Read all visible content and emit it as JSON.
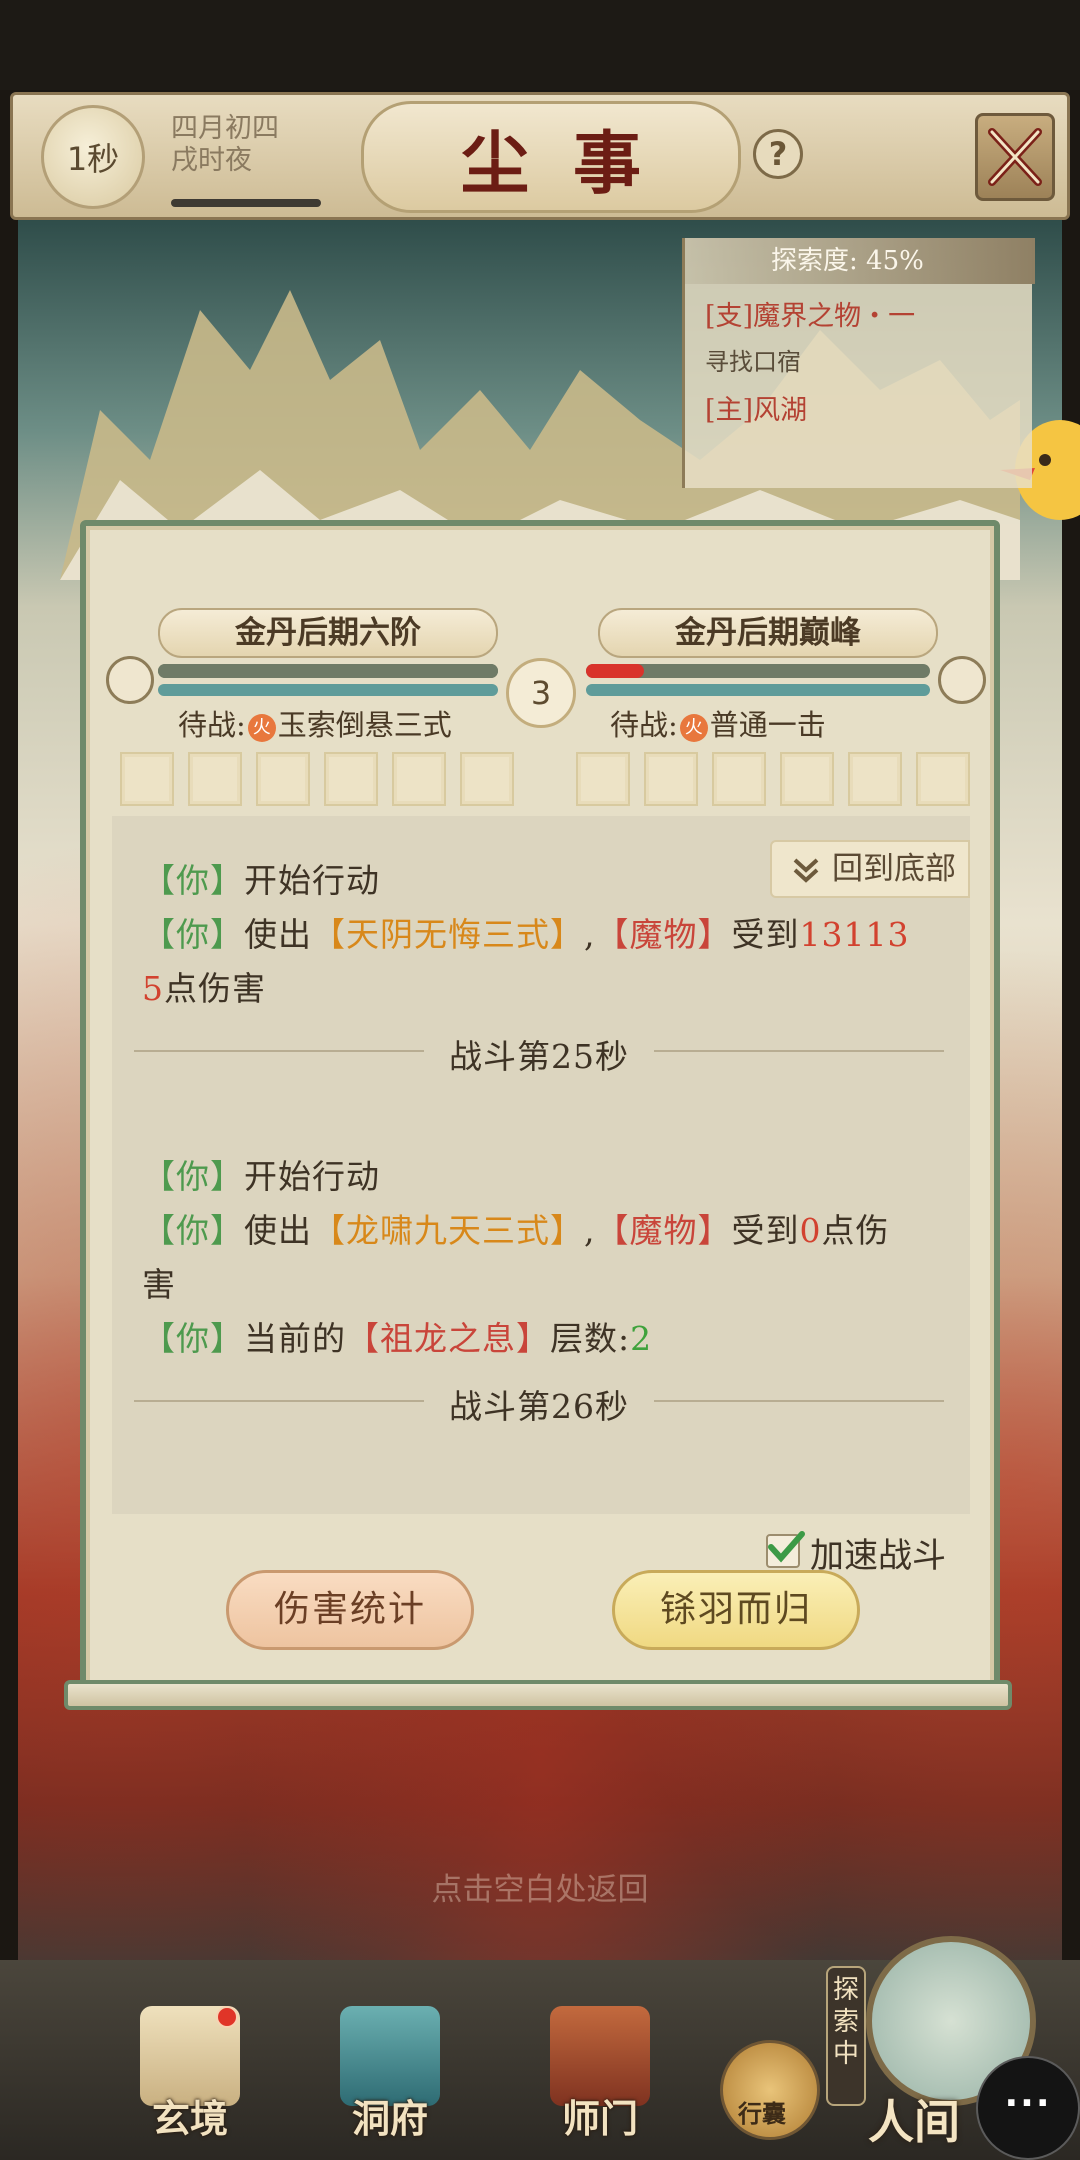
{
  "header": {
    "timer": "1秒",
    "date_line1": "四月初四",
    "date_line2": "戌时夜",
    "title": "尘事",
    "help": "?"
  },
  "quest": {
    "progress": "探索度: 45%",
    "item1": "[支]魔界之物・一",
    "item1_sub": "寻找口宿",
    "item2": "[主]风湖"
  },
  "battle": {
    "player_rank": "金丹后期六阶",
    "enemy_rank": "金丹后期巅峰",
    "round": "3",
    "player_wait_label": "待战:",
    "player_wait_skill": "玉索倒悬三式",
    "enemy_wait_label": "待战:",
    "enemy_wait_skill": "普通一击",
    "fire_glyph": "火",
    "enemy_hp_fraction": 0.17,
    "player_hp_fraction": 1.0,
    "back_to_bottom": "回到底部",
    "log": {
      "you": "【你】",
      "start_action": "开始行动",
      "use": "使出",
      "skill1": "【天阴无悔三式】",
      "comma": ",",
      "monster": "【魔物】",
      "received": "受到",
      "dmg1_a": "13113",
      "dmg1_b": "5",
      "dmg_suffix": "点伤害",
      "sep1": "战斗第25秒",
      "skill2": "【龙啸九天三式】",
      "dmg2": "0",
      "dmg2_suffix_a": "点伤",
      "dmg2_suffix_b": "害",
      "current_of": "当前的",
      "buff": "【祖龙之息】",
      "layers": "层数:",
      "layer_count": "2",
      "sep2": "战斗第26秒"
    },
    "speed_up": "加速战斗",
    "speed_up_checked": true,
    "btn_damage_stats": "伤害统计",
    "btn_return": "铩羽而归"
  },
  "hint": "点击空白处返回",
  "nav": {
    "item1": "玄境",
    "item2": "洞府",
    "item3": "师门",
    "bag": "行囊",
    "exploring": "探索中",
    "world": "人间",
    "more": "···"
  },
  "colors": {
    "frame_green": "#6f8a6a",
    "you_green": "#4e9a4e",
    "skill_orange": "#d8881a",
    "monster_red": "#c9453a",
    "title_red": "#6c1d14"
  }
}
